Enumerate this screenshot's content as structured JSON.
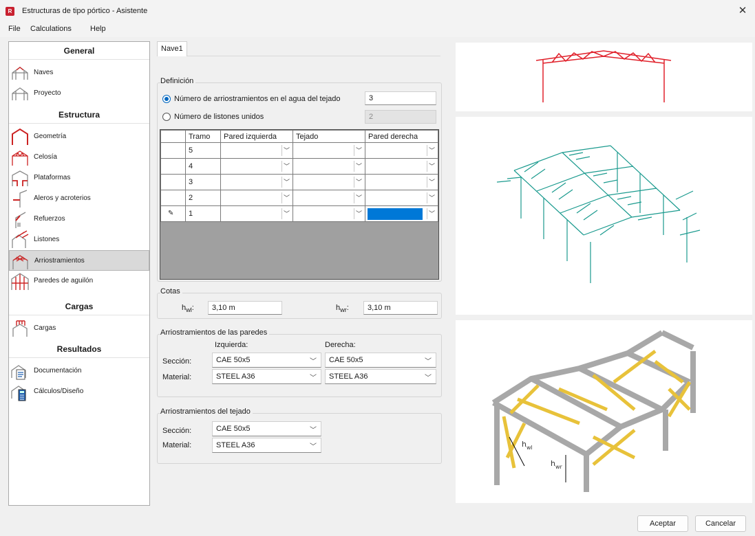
{
  "window": {
    "app_icon": "R",
    "title": "Estructuras de tipo pórtico - Asistente"
  },
  "menu": [
    "File",
    "Calculations",
    "Help"
  ],
  "sidebar": {
    "sections": [
      {
        "title": "General",
        "items": [
          {
            "label": "Naves",
            "icon": "frame-icon"
          },
          {
            "label": "Proyecto",
            "icon": "frame-icon"
          }
        ]
      },
      {
        "title": "Estructura",
        "items": [
          {
            "label": "Geometría",
            "icon": "geometry-icon"
          },
          {
            "label": "Celosía",
            "icon": "truss-icon"
          },
          {
            "label": "Plataformas",
            "icon": "platform-icon"
          },
          {
            "label": "Aleros y acroterios",
            "icon": "eaves-icon"
          },
          {
            "label": "Refuerzos",
            "icon": "haunch-icon"
          },
          {
            "label": "Listones",
            "icon": "purlins-icon"
          },
          {
            "label": "Arriostramientos",
            "icon": "bracing-icon",
            "active": true
          },
          {
            "label": "Paredes de aguilón",
            "icon": "gable-wall-icon"
          }
        ]
      },
      {
        "title": "Cargas",
        "items": [
          {
            "label": "Cargas",
            "icon": "loads-icon"
          }
        ]
      },
      {
        "title": "Resultados",
        "items": [
          {
            "label": "Documentación",
            "icon": "documentation-icon"
          },
          {
            "label": "Cálculos/Diseño",
            "icon": "calculator-icon"
          }
        ]
      }
    ]
  },
  "tab": "Nave1",
  "definicion": {
    "title": "Definición",
    "option1_label": "Número de arriostramientos en el agua del tejado",
    "option1_value": "3",
    "option2_label": "Número de listones unidos",
    "option2_value": "2",
    "selected": 1
  },
  "grid": {
    "headers": [
      "",
      "Tramo",
      "Pared izquierda",
      "Tejado",
      "Pared derecha"
    ],
    "rows": [
      "5",
      "4",
      "3",
      "2",
      "1"
    ]
  },
  "cotas": {
    "title": "Cotas",
    "hwl_label": "h",
    "hwl_sub": "wl",
    "hwl_value": "3,10 m",
    "hwr_label": "h",
    "hwr_sub": "wr",
    "hwr_value": "3,10 m"
  },
  "paredes": {
    "title": "Arriostramientos de las paredes",
    "left_header": "Izquierda:",
    "right_header": "Derecha:",
    "seccion_label": "Sección:",
    "material_label": "Material:",
    "left_seccion": "CAE 50x5",
    "right_seccion": "CAE 50x5",
    "left_material": "STEEL A36",
    "right_material": "STEEL A36"
  },
  "tejado": {
    "title": "Arriostramientos del tejado",
    "seccion_label": "Sección:",
    "material_label": "Material:",
    "seccion": "CAE 50x5",
    "material": "STEEL A36"
  },
  "preview_labels": {
    "hwl": "h",
    "hwl_sub": "wl",
    "hwr": "h",
    "hwr_sub": "wr"
  },
  "buttons": {
    "ok": "Aceptar",
    "cancel": "Cancelar"
  },
  "colors": {
    "accent": "#0067c0",
    "frame_red": "#e0202a",
    "wire_teal": "#1a9a8e",
    "brace_yellow": "#e8c23a",
    "steel_gray": "#a8a8a8"
  }
}
